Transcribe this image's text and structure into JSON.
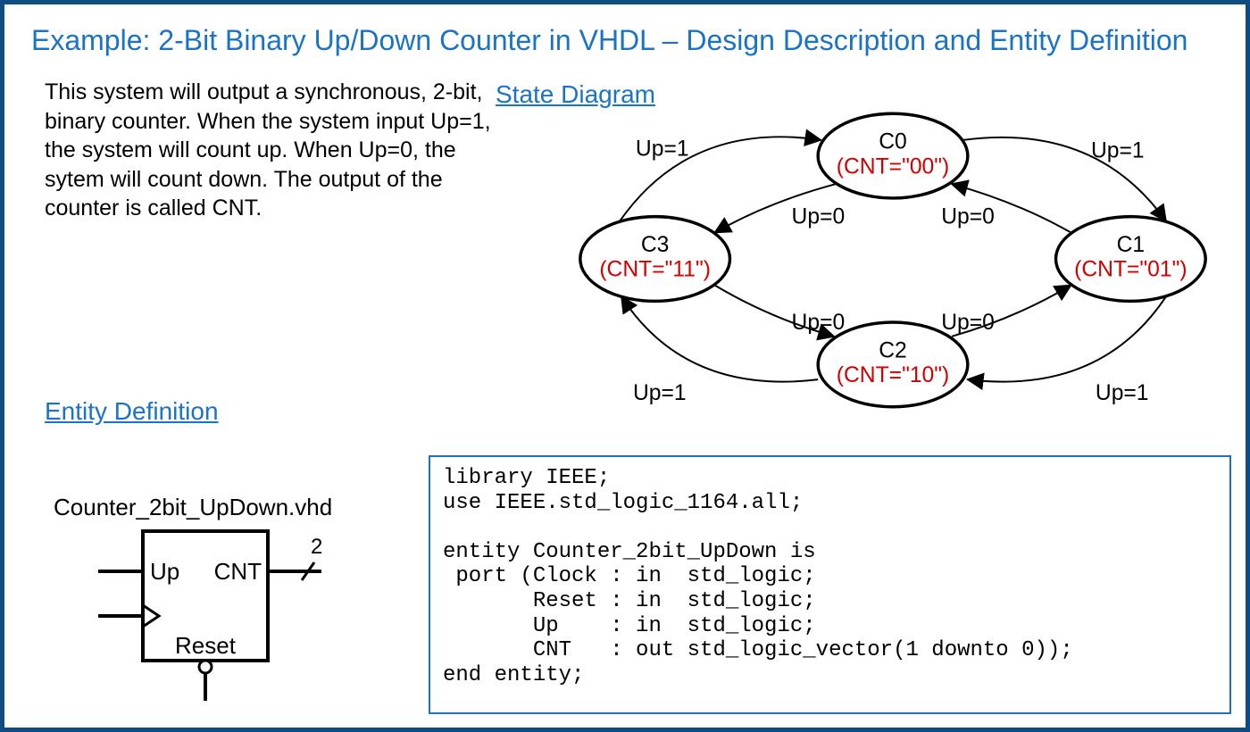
{
  "title": "Example: 2-Bit Binary Up/Down Counter in VHDL – Design Description and Entity Definition",
  "description": "This system will output a synchronous, 2-bit, binary counter.  When the system input Up=1, the system will count up.  When Up=0, the sytem will count down.  The output of the counter is called CNT.",
  "state_diagram_header": "State Diagram",
  "entity_header": "Entity Definition",
  "filename": "Counter_2bit_UpDown.vhd",
  "block": {
    "port_up": "Up",
    "port_cnt": "CNT",
    "port_reset": "Reset",
    "bus_width": "2"
  },
  "states": {
    "c0": {
      "name": "C0",
      "out": "(CNT=\"00\")"
    },
    "c1": {
      "name": "C1",
      "out": "(CNT=\"01\")"
    },
    "c2": {
      "name": "C2",
      "out": "(CNT=\"10\")"
    },
    "c3": {
      "name": "C3",
      "out": "(CNT=\"11\")"
    }
  },
  "edges": {
    "up1": "Up=1",
    "up0": "Up=0"
  },
  "code": "library IEEE;\nuse IEEE.std_logic_1164.all;\n\nentity Counter_2bit_UpDown is\n port (Clock : in  std_logic;\n       Reset : in  std_logic;\n       Up    : in  std_logic;\n       CNT   : out std_logic_vector(1 downto 0));\nend entity;"
}
